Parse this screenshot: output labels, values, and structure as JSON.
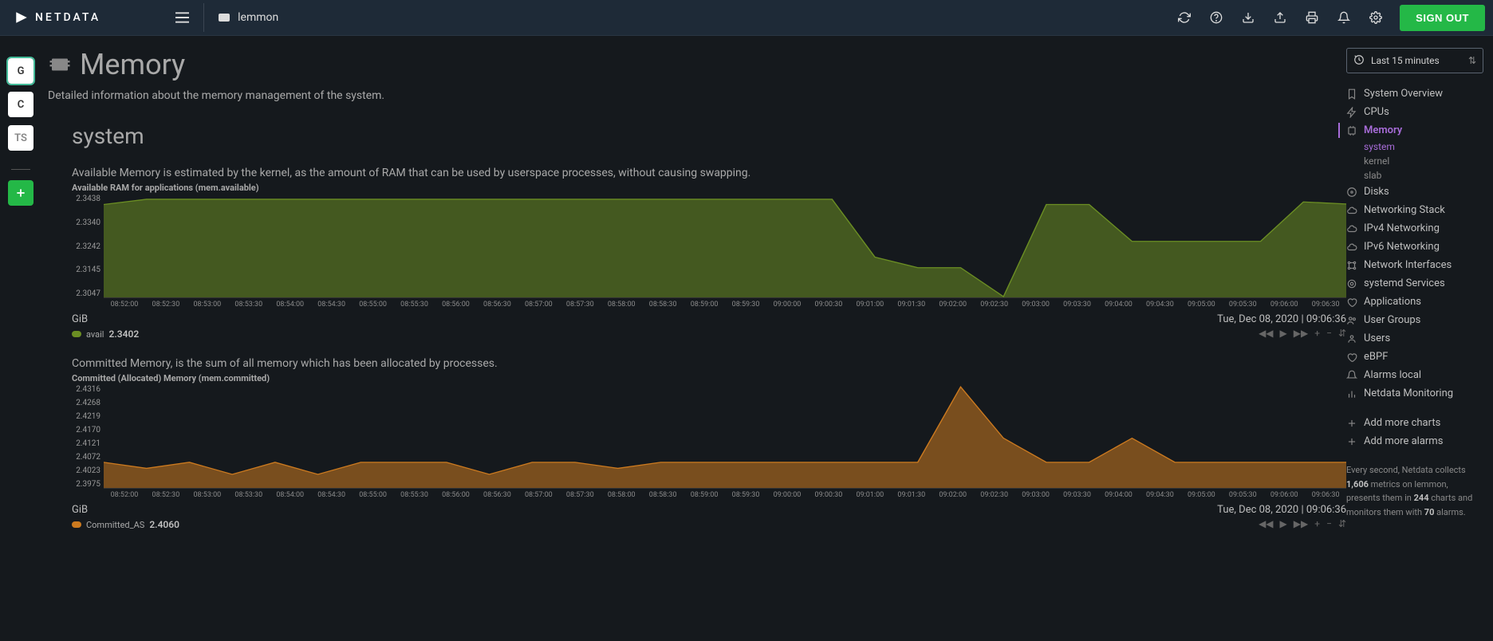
{
  "brand": "NETDATA",
  "host": "lemmon",
  "signout": "SIGN OUT",
  "workspaces": [
    "G",
    "C",
    "TS"
  ],
  "timerange": "Last 15 minutes",
  "page": {
    "title": "Memory",
    "desc": "Detailed information about the memory management of the system.",
    "section": "system"
  },
  "sidenav": {
    "items": [
      {
        "icon": "bookmark",
        "label": "System Overview"
      },
      {
        "icon": "bolt",
        "label": "CPUs"
      },
      {
        "icon": "chip",
        "label": "Memory",
        "active": true,
        "subs": [
          {
            "label": "system",
            "active": true
          },
          {
            "label": "kernel"
          },
          {
            "label": "slab"
          }
        ]
      },
      {
        "icon": "disk",
        "label": "Disks"
      },
      {
        "icon": "cloud",
        "label": "Networking Stack"
      },
      {
        "icon": "cloud",
        "label": "IPv4 Networking"
      },
      {
        "icon": "cloud",
        "label": "IPv6 Networking"
      },
      {
        "icon": "net",
        "label": "Network Interfaces"
      },
      {
        "icon": "gears",
        "label": "systemd Services"
      },
      {
        "icon": "heart",
        "label": "Applications"
      },
      {
        "icon": "users",
        "label": "User Groups"
      },
      {
        "icon": "user",
        "label": "Users"
      },
      {
        "icon": "heart",
        "label": "eBPF"
      },
      {
        "icon": "bell",
        "label": "Alarms local"
      },
      {
        "icon": "bar",
        "label": "Netdata Monitoring"
      }
    ],
    "add_charts": "Add more charts",
    "add_alarms": "Add more alarms",
    "footer": {
      "pre": "Every second, Netdata collects ",
      "metrics": "1,606",
      "mid1": " metrics on lemmon, presents them in ",
      "charts": "244",
      "mid2": " charts and monitors them with ",
      "alarms": "70",
      "post": " alarms."
    }
  },
  "timestamp": "Tue, Dec 08, 2020 | 09:06:36",
  "xlabels": [
    "08:52:00",
    "08:52:30",
    "08:53:00",
    "08:53:30",
    "08:54:00",
    "08:54:30",
    "08:55:00",
    "08:55:30",
    "08:56:00",
    "08:56:30",
    "08:57:00",
    "08:57:30",
    "08:58:00",
    "08:58:30",
    "08:59:00",
    "08:59:30",
    "09:00:00",
    "09:00:30",
    "09:01:00",
    "09:01:30",
    "09:02:00",
    "09:02:30",
    "09:03:00",
    "09:03:30",
    "09:04:00",
    "09:04:30",
    "09:05:00",
    "09:05:30",
    "09:06:00",
    "09:06:30"
  ],
  "charts": [
    {
      "desc": "Available Memory is estimated by the kernel, as the amount of RAM that can be used by userspace processes, without causing swapping.",
      "title": "Available RAM for applications (mem.available)",
      "unit": "GiB",
      "yticks": [
        "2.3438",
        "2.3340",
        "2.3242",
        "2.3145",
        "2.3047"
      ],
      "legend": {
        "color": "#6b8e23",
        "name": "avail",
        "value": "2.3402"
      }
    },
    {
      "desc": "Committed Memory, is the sum of all memory which has been allocated by processes.",
      "title": "Committed (Allocated) Memory (mem.committed)",
      "unit": "GiB",
      "yticks": [
        "2.4316",
        "2.4268",
        "2.4219",
        "2.4170",
        "2.4121",
        "2.4072",
        "2.4023",
        "2.3975"
      ],
      "legend": {
        "color": "#cc7a1f",
        "name": "Committed_AS",
        "value": "2.4060"
      }
    }
  ],
  "chart_data": [
    {
      "type": "area",
      "title": "Available RAM for applications (mem.available)",
      "ylabel": "GiB",
      "ylim": [
        2.3047,
        2.3438
      ],
      "x": [
        "08:52:00",
        "08:52:30",
        "08:53:00",
        "08:53:30",
        "08:54:00",
        "08:54:30",
        "08:55:00",
        "08:55:30",
        "08:56:00",
        "08:56:30",
        "08:57:00",
        "08:57:30",
        "08:58:00",
        "08:58:30",
        "08:59:00",
        "08:59:30",
        "09:00:00",
        "09:00:30",
        "09:01:00",
        "09:01:30",
        "09:02:00",
        "09:02:30",
        "09:03:00",
        "09:03:30",
        "09:04:00",
        "09:04:30",
        "09:05:00",
        "09:05:30",
        "09:06:00",
        "09:06:30"
      ],
      "series": [
        {
          "name": "avail",
          "color": "#6b8e23",
          "values": [
            2.34,
            2.342,
            2.342,
            2.342,
            2.342,
            2.342,
            2.342,
            2.342,
            2.342,
            2.342,
            2.342,
            2.342,
            2.342,
            2.342,
            2.342,
            2.342,
            2.342,
            2.342,
            2.32,
            2.316,
            2.316,
            2.305,
            2.34,
            2.34,
            2.326,
            2.326,
            2.326,
            2.326,
            2.341,
            2.3402
          ]
        }
      ]
    },
    {
      "type": "area",
      "title": "Committed (Allocated) Memory (mem.committed)",
      "ylabel": "GiB",
      "ylim": [
        2.3975,
        2.4316
      ],
      "x": [
        "08:52:00",
        "08:52:30",
        "08:53:00",
        "08:53:30",
        "08:54:00",
        "08:54:30",
        "08:55:00",
        "08:55:30",
        "08:56:00",
        "08:56:30",
        "08:57:00",
        "08:57:30",
        "08:58:00",
        "08:58:30",
        "08:59:00",
        "08:59:30",
        "09:00:00",
        "09:00:30",
        "09:01:00",
        "09:01:30",
        "09:02:00",
        "09:02:30",
        "09:03:00",
        "09:03:30",
        "09:04:00",
        "09:04:30",
        "09:05:00",
        "09:05:30",
        "09:06:00",
        "09:06:30"
      ],
      "series": [
        {
          "name": "Committed_AS",
          "color": "#cc7a1f",
          "values": [
            2.406,
            2.404,
            2.406,
            2.402,
            2.406,
            2.402,
            2.406,
            2.406,
            2.406,
            2.402,
            2.406,
            2.406,
            2.404,
            2.406,
            2.406,
            2.406,
            2.406,
            2.406,
            2.406,
            2.406,
            2.431,
            2.414,
            2.406,
            2.406,
            2.414,
            2.406,
            2.406,
            2.406,
            2.406,
            2.406
          ]
        }
      ]
    }
  ]
}
